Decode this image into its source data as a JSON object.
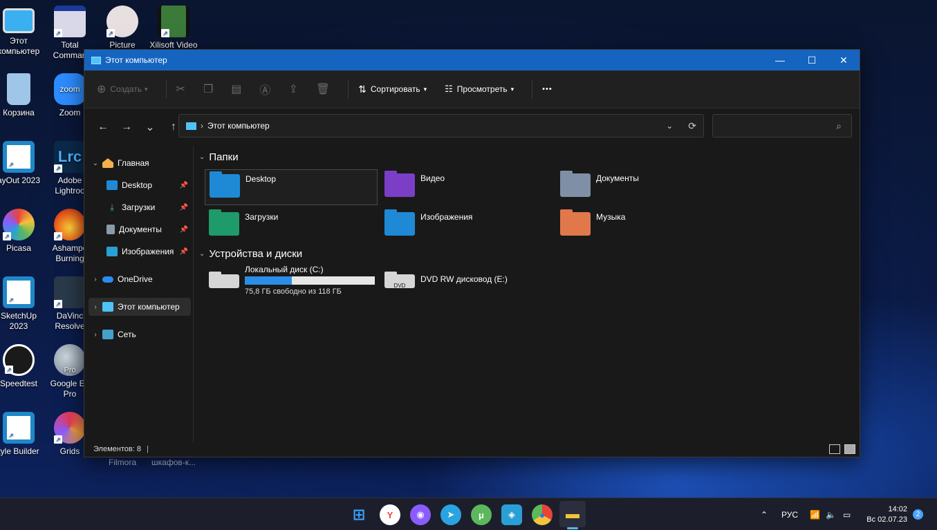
{
  "desktop": {
    "icons": [
      {
        "label": "Этот компьютер",
        "color": "#3ab0f0"
      },
      {
        "label": "Total Comman",
        "color": "#d8d8e8"
      },
      {
        "label": "Picture",
        "color": "#e8e0e0"
      },
      {
        "label": "Xilisoft Video",
        "color": "#3c7a3a"
      },
      {
        "label": "Корзина",
        "color": "#9fc5e8"
      },
      {
        "label": "Zoom",
        "color": "#2d8cff"
      },
      {
        "label": "ayOut 2023",
        "color": "#1e88c8"
      },
      {
        "label": "Adobe Lightroo",
        "color": "#0b2a4a"
      },
      {
        "label": "Picasa",
        "color": "#e0a020"
      },
      {
        "label": "Ashampo Burning",
        "color": "#e85a1a"
      },
      {
        "label": "SketchUp 2023",
        "color": "#1e88c8"
      },
      {
        "label": "DaVinc Resolve",
        "color": "#2a3a4a"
      },
      {
        "label": "Speedtest",
        "color": "#1a1a1a"
      },
      {
        "label": "Google Ea Pro",
        "color": "#8a9aaa"
      },
      {
        "label": "tyle Builder",
        "color": "#1e88c8"
      },
      {
        "label": "Grids",
        "color": "#e83a5a"
      }
    ],
    "zoom_text": "zoom",
    "lr_text": "Lrc",
    "pro_text": "Pro",
    "behind_labels": [
      "Filmora",
      "шкафов-к..."
    ]
  },
  "window": {
    "title": "Этот компьютер",
    "controls": {
      "minimize": "—",
      "maximize": "☐",
      "close": "✕"
    },
    "toolbar": {
      "create": "Создать",
      "sort": "Сортировать",
      "view": "Просмотреть",
      "more": "•••"
    },
    "nav": {
      "back": "←",
      "forward": "→",
      "recent": "⌄",
      "up": "↑"
    },
    "address": {
      "sep": "›",
      "path": "Этот компьютер",
      "dropdown": "⌄",
      "refresh": "⟳"
    },
    "search": {
      "placeholder": "",
      "icon": "⌕"
    },
    "sidebar": {
      "home": "Главная",
      "quick": [
        {
          "label": "Desktop"
        },
        {
          "label": "Загрузки"
        },
        {
          "label": "Документы"
        },
        {
          "label": "Изображения"
        }
      ],
      "onedrive": "OneDrive",
      "thispc": "Этот компьютер",
      "network": "Сеть"
    },
    "sections": {
      "folders": "Папки",
      "devices": "Устройства и диски"
    },
    "folders": [
      {
        "label": "Desktop",
        "color": "#1e8ad6"
      },
      {
        "label": "Видео",
        "color": "#7b3fc7"
      },
      {
        "label": "Документы",
        "color": "#7f8fa6"
      },
      {
        "label": "Загрузки",
        "color": "#1f9a6a"
      },
      {
        "label": "Изображения",
        "color": "#1e8ad6"
      },
      {
        "label": "Музыка",
        "color": "#e0784a"
      }
    ],
    "drives": [
      {
        "label": "Локальный диск (C:)",
        "info": "75,8 ГБ свободно из 118 ГБ",
        "used_fraction": 0.36
      },
      {
        "label": "DVD RW дисковод (E:)",
        "badge": "DVD"
      }
    ],
    "status": {
      "count": "Элементов: 8"
    }
  },
  "taskbar": {
    "apps": [
      {
        "name": "windows",
        "glyph": "⊞",
        "color": "#3aa0ff"
      },
      {
        "name": "yandex",
        "glyph": "Y",
        "color": "#ffffff"
      },
      {
        "name": "alice",
        "glyph": "◉",
        "color": "#8a5cff"
      },
      {
        "name": "telegram",
        "glyph": "➤",
        "color": "#2aa3e0"
      },
      {
        "name": "utorrent",
        "glyph": "μ",
        "color": "#5cb85c"
      },
      {
        "name": "anydesk",
        "glyph": "◈",
        "color": "#2a9fd6"
      },
      {
        "name": "chrome",
        "glyph": "●",
        "color": "#e8443a"
      },
      {
        "name": "explorer",
        "glyph": "▬",
        "color": "#f3c33c"
      }
    ],
    "tray": {
      "chevron": "⌃",
      "lang": "РУС",
      "time": "14:02",
      "date": "Вс 02.07.23",
      "notif": "2"
    }
  }
}
